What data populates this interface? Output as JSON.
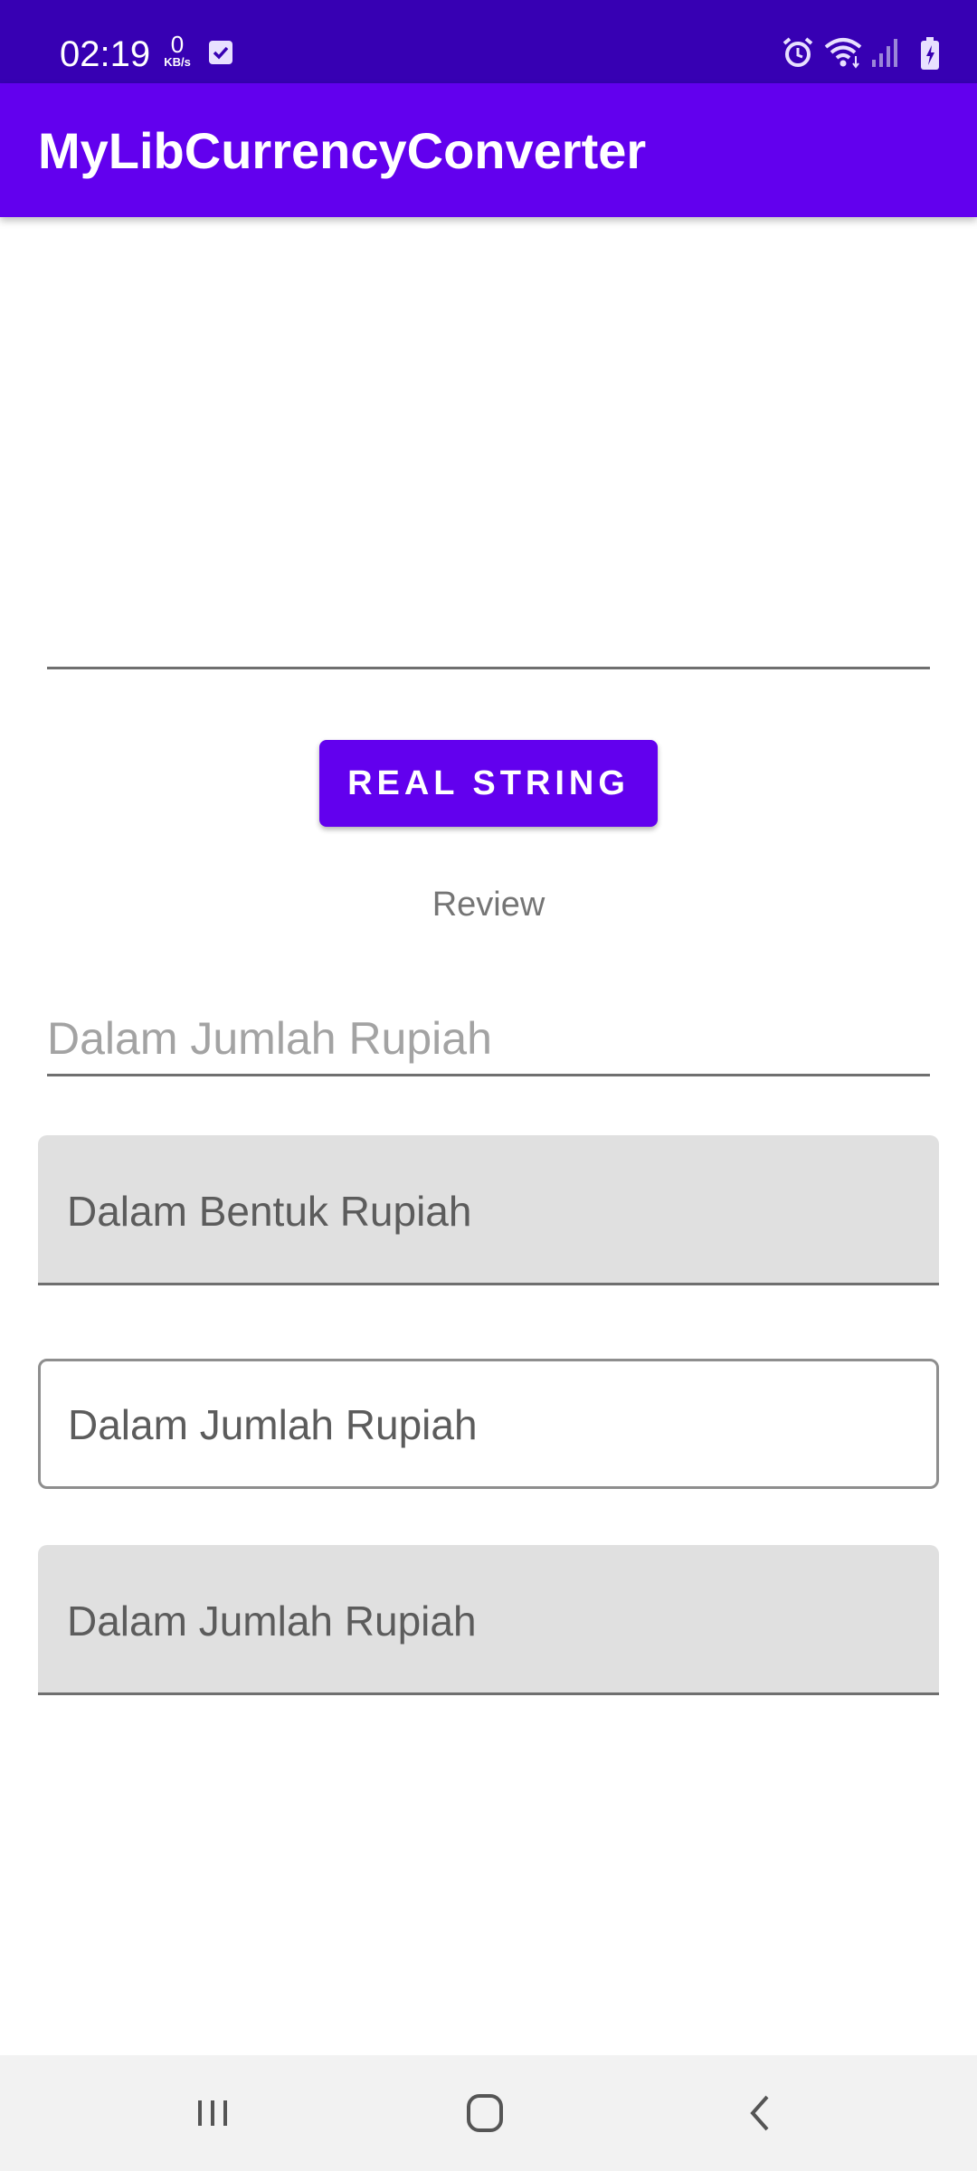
{
  "status_bar": {
    "time": "02:19",
    "net_speed_value": "0",
    "net_speed_unit": "KB/s",
    "icons": [
      "check-box-icon",
      "alarm-icon",
      "wifi-icon",
      "signal-icon",
      "battery-charging-icon"
    ]
  },
  "app_bar": {
    "title": "MyLibCurrencyConverter"
  },
  "form": {
    "top_input_value": "",
    "button_label": "REAL STRING",
    "review_text": "Review",
    "amount_input_placeholder": "Dalam Jumlah Rupiah",
    "field_bentuk": "Dalam Bentuk Rupiah",
    "field_jumlah_outlined": "Dalam Jumlah Rupiah",
    "field_jumlah_filled": "Dalam Jumlah Rupiah"
  },
  "nav_bar": {
    "icons": [
      "recent-apps-icon",
      "home-icon",
      "back-icon"
    ]
  },
  "colors": {
    "status_bar": "#3700b3",
    "primary": "#6200ee",
    "filled_field": "#e0e0e0",
    "nav_bar": "#f2f2f2"
  }
}
